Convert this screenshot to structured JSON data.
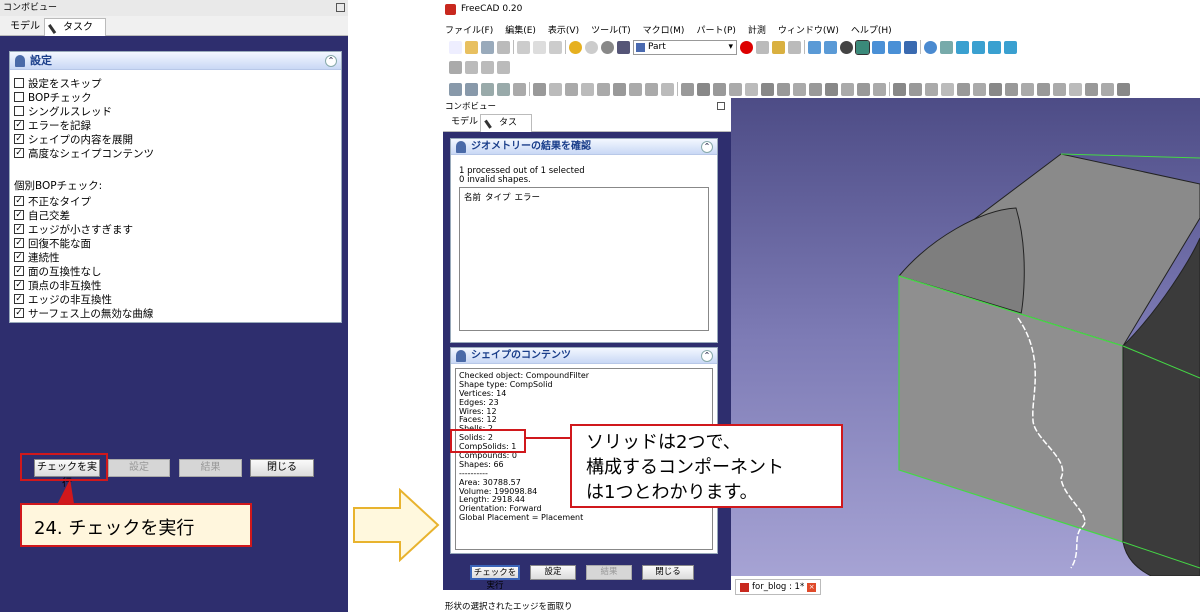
{
  "left_panel": {
    "title": "コンボビュー",
    "tabs": [
      "モデル",
      "タスク"
    ],
    "settings_header": "設定",
    "checkboxes": [
      {
        "label": "設定をスキップ",
        "checked": false
      },
      {
        "label": "BOPチェック",
        "checked": false
      },
      {
        "label": "シングルスレッド",
        "checked": false
      },
      {
        "label": "エラーを記録",
        "checked": true
      },
      {
        "label": "シェイプの内容を展開",
        "checked": true
      },
      {
        "label": "高度なシェイプコンテンツ",
        "checked": true
      }
    ],
    "individual_label": "個別BOPチェック:",
    "individual_checks": [
      "不正なタイプ",
      "自己交差",
      "エッジが小さすぎます",
      "回復不能な面",
      "連続性",
      "面の互換性なし",
      "頂点の非互換性",
      "エッジの非互換性",
      "サーフェス上の無効な曲線"
    ],
    "buttons": {
      "run": "チェックを実行",
      "settings": "設定",
      "results": "結果",
      "close": "閉じる"
    }
  },
  "callout_left": "24. チェックを実行",
  "callout_right": [
    "ソリッドは2つで、",
    "構成するコンポーネント",
    "は1つとわかります。"
  ],
  "freecad": {
    "window_title": "FreeCAD 0.20",
    "menu": [
      "ファイル(F)",
      "編集(E)",
      "表示(V)",
      "ツール(T)",
      "マクロ(M)",
      "パート(P)",
      "計測",
      "ウィンドウ(W)",
      "ヘルプ(H)"
    ],
    "workbench": "Part",
    "panel_title": "コンボビュー",
    "tabs": [
      "モデル",
      "タスク"
    ],
    "geom_header": "ジオメトリーの結果を確認",
    "geom_lines": [
      "1 processed out of 1 selected",
      "0 invalid shapes."
    ],
    "table_headers": [
      "名前",
      "タイプ",
      "エラー"
    ],
    "shape_header": "シェイプのコンテンツ",
    "shape_lines": [
      "Checked object: CompoundFilter",
      "Shape type: CompSolid",
      "Vertices: 14",
      "Edges: 23",
      "Wires: 12",
      "Faces: 12",
      "Shells: 2",
      "Solids: 2",
      "CompSolids: 1",
      "Compounds: 0",
      "Shapes: 66",
      "----------",
      "Area: 30788.57",
      "Volume: 199098.84",
      "Length: 2918.44",
      "Orientation: Forward",
      "Global Placement = Placement"
    ],
    "buttons": {
      "run": "チェックを実行",
      "settings": "設定",
      "results": "結果",
      "close": "閉じる"
    },
    "doc_tab": "for_blog : 1*",
    "status": "形状の選択されたエッジを面取り"
  }
}
